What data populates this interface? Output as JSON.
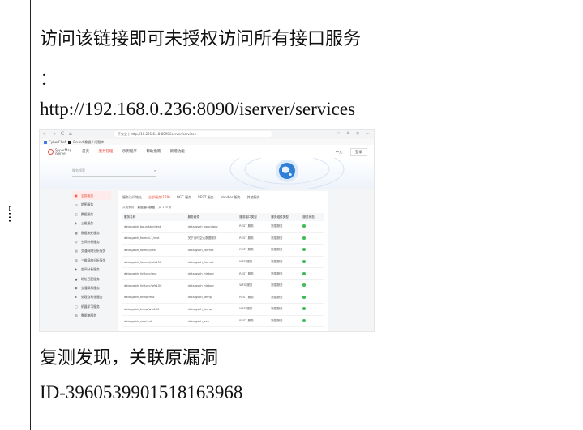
{
  "document": {
    "margin_glyph": "程",
    "line1": "访问该链接即可未授权访问所有接口服务",
    "line2": "：",
    "line3": "http://192.168.0.236:8090/iserver/services",
    "line4": "复测发现，关联原漏洞",
    "line5": "ID-3960539901518163968"
  },
  "screenshot": {
    "browser": {
      "nav_glyphs": "← → C ⌂",
      "url": "不安全 | http://10.201.64.8:8090/iserver/services",
      "ext_glyphs": "☆ ⊕ ◎ ⋯",
      "bookmarks": [
        "CyberChef",
        "Bound 数据 / 问题库"
      ]
    },
    "header": {
      "logo_text": "SuperMap iServer",
      "menu": [
        "首页",
        "服务管理",
        "示例程序",
        "帮助指南",
        "新增功能"
      ],
      "active_menu_index": 1,
      "lang": "中文",
      "user": "登录"
    },
    "search_placeholder": "服务搜索",
    "sidebar": [
      {
        "icon": "▣",
        "label": "全部服务",
        "active": true
      },
      {
        "icon": "▭",
        "label": "地图服务"
      },
      {
        "icon": "◫",
        "label": "数据服务"
      },
      {
        "icon": "◈",
        "label": "三维服务"
      },
      {
        "icon": "▦",
        "label": "数据流处服务"
      },
      {
        "icon": "◎",
        "label": "空间分析服务"
      },
      {
        "icon": "▤",
        "label": "交通网络分析服务"
      },
      {
        "icon": "▥",
        "label": "三维网络分析服务"
      },
      {
        "icon": "◆",
        "label": "空间分析服务"
      },
      {
        "icon": "◢",
        "label": "地址匹配服务"
      },
      {
        "icon": "◉",
        "label": "交通换乘服务"
      },
      {
        "icon": "▶",
        "label": "处理自动化服务"
      },
      {
        "icon": "▢",
        "label": "机器学习服务"
      },
      {
        "icon": "▧",
        "label": "数据流服务"
      }
    ],
    "tabs": [
      "服务访问地址",
      "全部服务(178)",
      "OGC 服务",
      "REST 服务",
      "Handler 服务",
      "其他服务"
    ],
    "active_tab_index": 1,
    "meta": {
      "prefix": "共搜索到",
      "current": "数据接口数据",
      "count": "共 178 条"
    },
    "table": {
      "headers": [
        "服务名称",
        "服务组件",
        "服务接口类型",
        "服务组件类型",
        "服务状态"
      ],
      "rows": [
        [
          "data-gsbh_boundary/rest",
          "data-gsbh_boundary",
          "REST 服务",
          "数据服务"
        ],
        [
          "data-gsbh_format-1/rest",
          "关于对时空大数据服务",
          "REST 服务",
          "数据服务"
        ],
        [
          "data-gsbh_format/rest",
          "data-gsbh_format",
          "REST 服务",
          "数据服务"
        ],
        [
          "data-gsbh_format/wfs100",
          "data-gsbh_format",
          "WFS 服务",
          "数据服务"
        ],
        [
          "data-gsbh_history/rest",
          "data-gsbh_history",
          "REST 服务",
          "数据服务"
        ],
        [
          "data-gsbh_history/wfs100",
          "data-gsbh_history",
          "WFS 服务",
          "数据服务"
        ],
        [
          "data-gsbh_temp/rest",
          "data-gsbh_temp",
          "REST 服务",
          "数据服务"
        ],
        [
          "data-gsbh_temp/wfs100",
          "data-gsbh_temp",
          "WFS 服务",
          "数据服务"
        ],
        [
          "data-gsbh_xxx/rest",
          "data-gsbh_xxx",
          "REST 服务",
          "数据服务"
        ],
        [
          "datacatalog/rest",
          "datacatalog",
          "REST 服务",
          "数据目录服务"
        ],
        [
          "geometry/restjsr",
          "geometry",
          "REST 服务",
          "几何服务"
        ],
        [
          "map-gsbh_boundary/rest",
          "map-gsbh_boundary",
          "REST 服务",
          "地图服务"
        ]
      ]
    },
    "colors": {
      "accent": "#e94b3c",
      "status_ok": "#3cba54",
      "globe": "#2f7fd6"
    }
  }
}
